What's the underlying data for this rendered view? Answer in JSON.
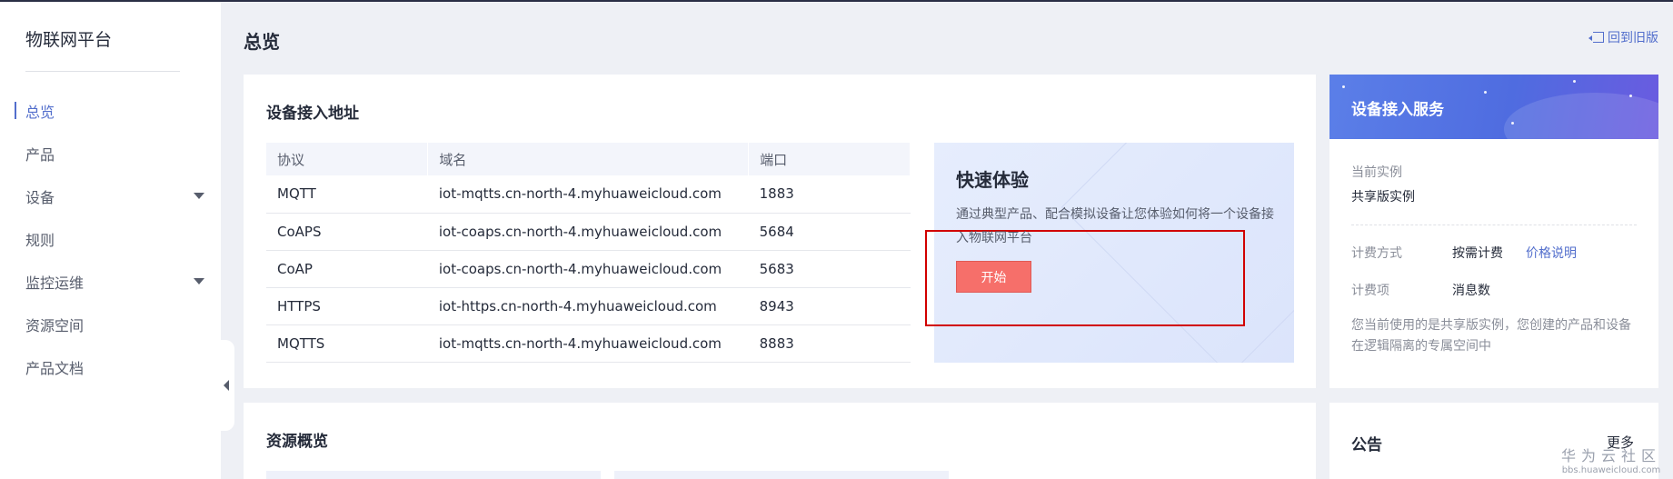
{
  "sidebar": {
    "title": "物联网平台",
    "items": [
      {
        "label": "总览"
      },
      {
        "label": "产品"
      },
      {
        "label": "设备"
      },
      {
        "label": "规则"
      },
      {
        "label": "监控运维"
      },
      {
        "label": "资源空间"
      },
      {
        "label": "产品文档"
      }
    ]
  },
  "header": {
    "title": "总览",
    "back_label": "回到旧版"
  },
  "access": {
    "title": "设备接入地址",
    "columns": [
      "协议",
      "域名",
      "端口"
    ],
    "rows": [
      [
        "MQTT",
        "iot-mqtts.cn-north-4.myhuaweicloud.com",
        "1883"
      ],
      [
        "CoAPS",
        "iot-coaps.cn-north-4.myhuaweicloud.com",
        "5684"
      ],
      [
        "CoAP",
        "iot-coaps.cn-north-4.myhuaweicloud.com",
        "5683"
      ],
      [
        "HTTPS",
        "iot-https.cn-north-4.myhuaweicloud.com",
        "8943"
      ],
      [
        "MQTTS",
        "iot-mqtts.cn-north-4.myhuaweicloud.com",
        "8883"
      ]
    ]
  },
  "quick": {
    "title": "快速体验",
    "desc": "通过典型产品、配合模拟设备让您体验如何将一个设备接入物联网平台",
    "button": "开始"
  },
  "resource": {
    "title": "资源概览"
  },
  "service": {
    "title": "设备接入服务",
    "instance_label": "当前实例",
    "instance_value": "共享版实例",
    "billing_label": "计费方式",
    "billing_value": "按需计费",
    "billing_link": "价格说明",
    "item_label": "计费项",
    "item_value": "消息数",
    "desc": "您当前使用的是共享版实例，您创建的产品和设备在逻辑隔离的专属空间中"
  },
  "notice": {
    "title": "公告",
    "more": "更多"
  },
  "watermark": {
    "line1": "华为云社区",
    "line2": "bbs.huaweicloud.com"
  },
  "colors": {
    "accent": "#526ecc",
    "start_button": "#f66f6a",
    "highlight": "#d10000"
  }
}
